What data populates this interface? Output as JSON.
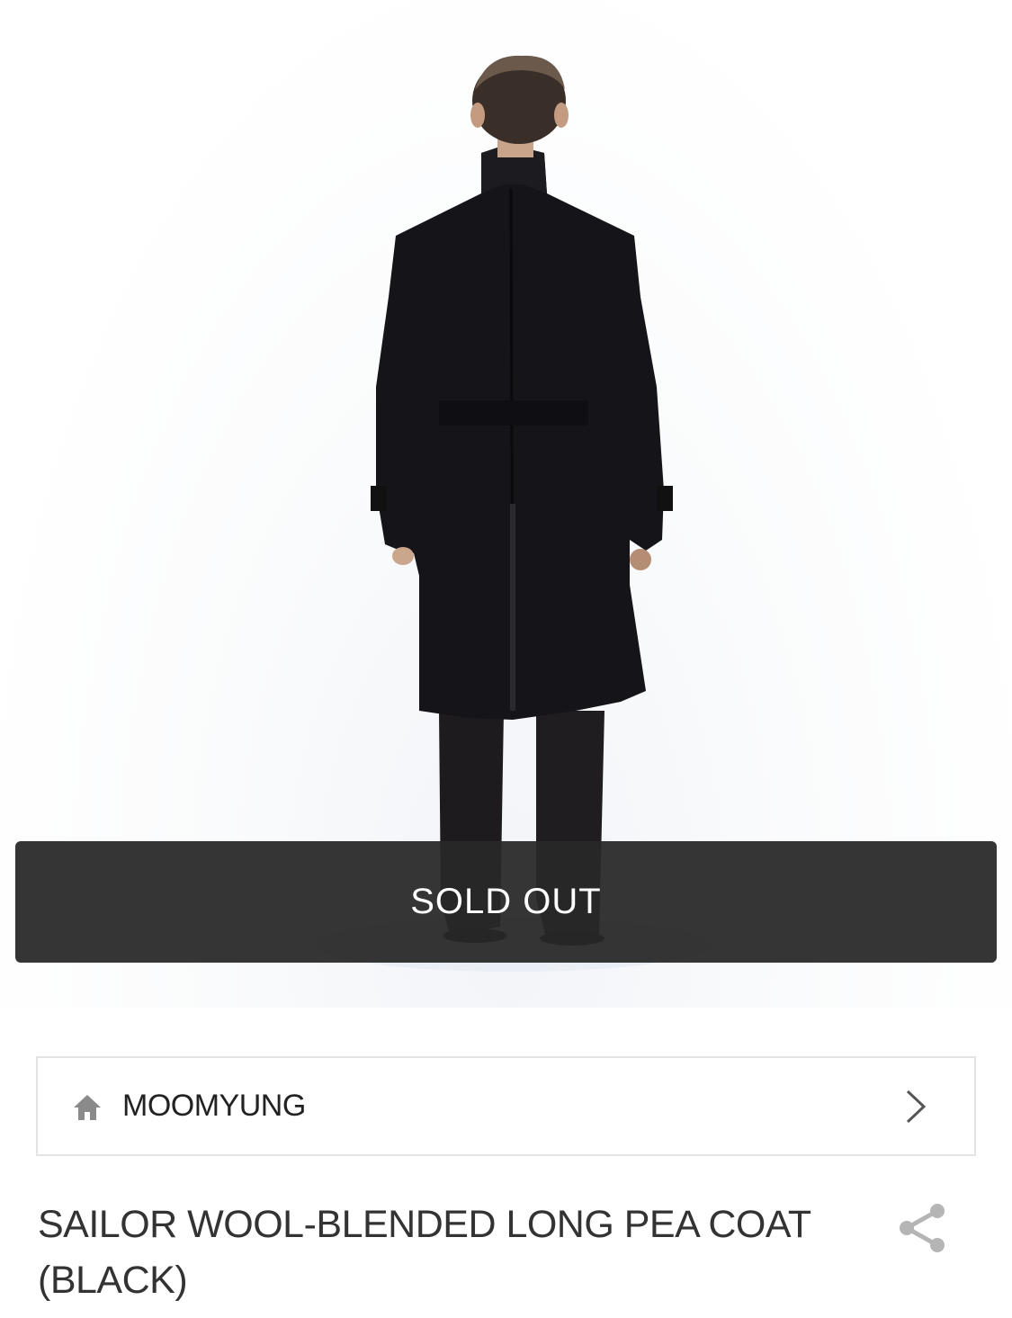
{
  "product_image": {
    "description_icon": "product-photo"
  },
  "sold_out": {
    "label": "SOLD OUT",
    "bg_color": "#2b2b2b"
  },
  "brand": {
    "name": "MOOMYUNG",
    "home_icon": "home-icon",
    "chevron_icon": "chevron-right-icon"
  },
  "product": {
    "title": "SAILOR WOOL-BLENDED LONG PEA COAT(BLACK)",
    "share_icon": "share-icon"
  }
}
